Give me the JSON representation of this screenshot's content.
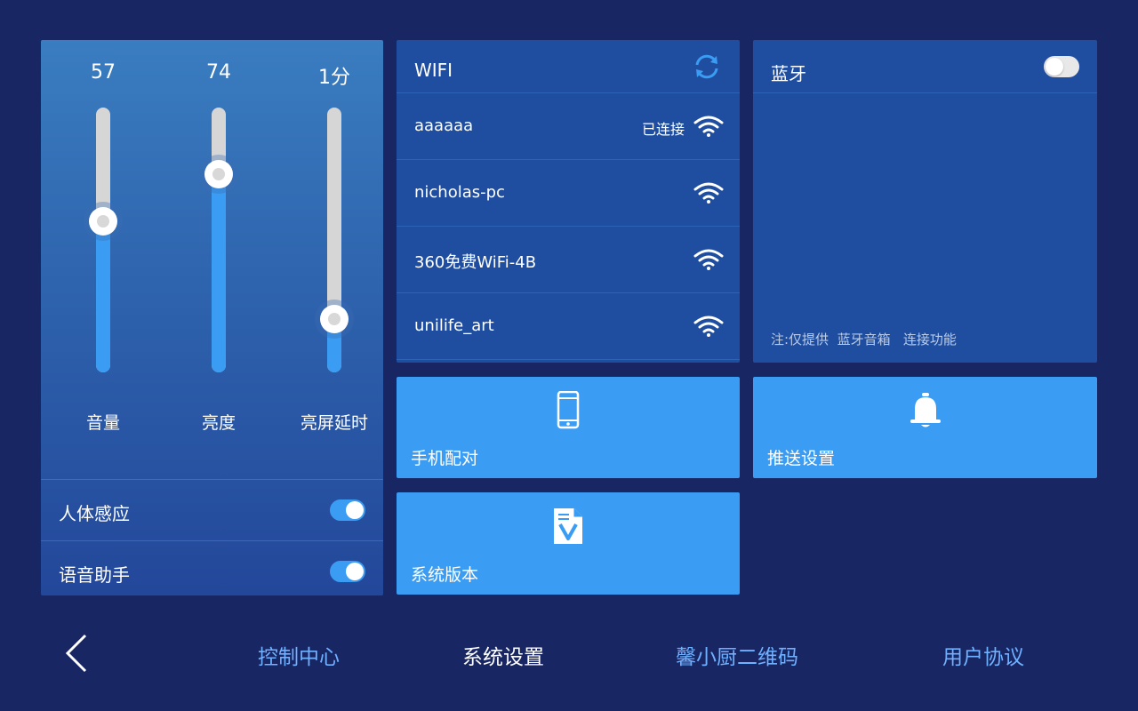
{
  "colors": {
    "background": "#182663",
    "panel": "#1f4ea0",
    "accent": "#3a9cf2",
    "nav_inactive": "#6fb0ff"
  },
  "sliders": [
    {
      "value_text": "57",
      "label": "音量",
      "level": 0.57
    },
    {
      "value_text": "74",
      "label": "亮度",
      "level": 0.75
    },
    {
      "value_text": "1分",
      "label": "亮屏延时",
      "level": 0.2
    }
  ],
  "toggles": [
    {
      "label": "人体感应",
      "on": true
    },
    {
      "label": "语音助手",
      "on": true
    }
  ],
  "wifi": {
    "title": "WIFI",
    "refresh_icon": "refresh-icon",
    "networks": [
      {
        "ssid": "aaaaaa",
        "status": "已连接",
        "icon": "wifi-icon"
      },
      {
        "ssid": "nicholas-pc",
        "status": "",
        "icon": "wifi-icon"
      },
      {
        "ssid": "360免费WiFi-4B",
        "status": "",
        "icon": "wifi-icon"
      },
      {
        "ssid": "unilife_art",
        "status": "",
        "icon": "wifi-icon"
      }
    ]
  },
  "bluetooth": {
    "title": "蓝牙",
    "on": false,
    "note": "注:仅提供  蓝牙音箱   连接功能"
  },
  "tiles": [
    {
      "label": "手机配对",
      "icon": "phone-icon"
    },
    {
      "label": "推送设置",
      "icon": "bell-icon"
    },
    {
      "label": "系统版本",
      "icon": "version-icon"
    }
  ],
  "nav": {
    "back_icon": "back-icon",
    "items": [
      {
        "label": "控制中心",
        "active": false
      },
      {
        "label": "系统设置",
        "active": true
      },
      {
        "label": "馨小厨二维码",
        "active": false
      },
      {
        "label": "用户协议",
        "active": false
      }
    ]
  }
}
